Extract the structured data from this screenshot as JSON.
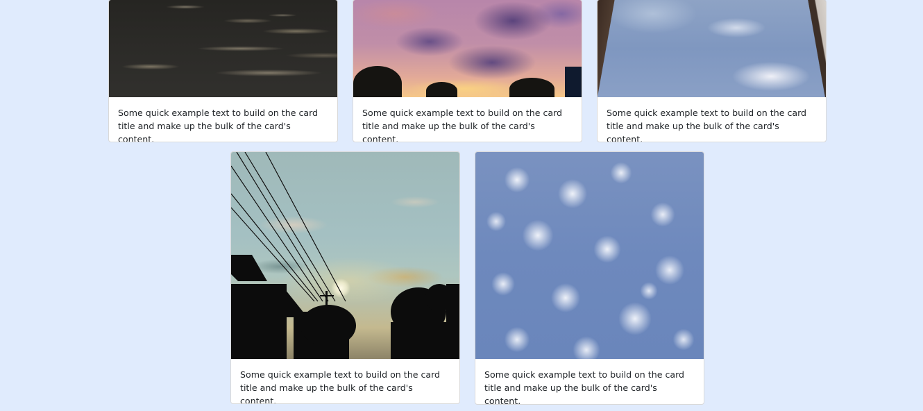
{
  "cards": [
    {
      "image_alt": "dark night clouds",
      "text": "Some quick example text to build on the card title and make up the bulk of the card's content."
    },
    {
      "image_alt": "purple sunset clouds",
      "text": "Some quick example text to build on the card title and make up the bulk of the card's content."
    },
    {
      "image_alt": "blue sky between buildings",
      "text": "Some quick example text to build on the card title and make up the bulk of the card's content."
    },
    {
      "image_alt": "sunset with power lines",
      "text": "Some quick example text to build on the card title and make up the bulk of the card's content."
    },
    {
      "image_alt": "cumulus clouds",
      "text": "Some quick example text to build on the card title and make up the bulk of the card's content."
    }
  ],
  "colors": {
    "page_background": "#e0ebfd",
    "card_background": "#ffffff",
    "text": "#212529"
  }
}
